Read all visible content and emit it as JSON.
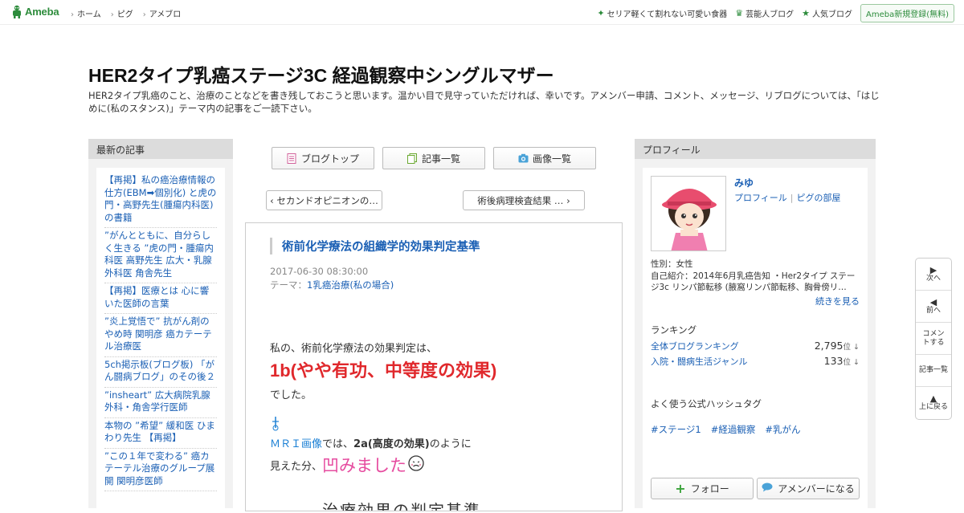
{
  "header": {
    "logo_text": "Ameba",
    "nav": [
      "ホーム",
      "ピグ",
      "アメブロ"
    ],
    "right_links": [
      {
        "icon": "sparkle-icon",
        "label": "セリア軽くて割れない可愛い食器"
      },
      {
        "icon": "crown-icon",
        "label": "芸能人ブログ"
      },
      {
        "icon": "star-icon",
        "label": "人気ブログ"
      }
    ],
    "register_label": "Ameba新規登録(無料)",
    "accent_color": "#2d8c3c"
  },
  "blog": {
    "title": "HER2タイプ乳癌ステージ3C 経過観察中シングルマザー",
    "description": "HER2タイプ乳癌のこと、治療のことなどを書き残しておこうと思います。温かい目で見守っていただければ、幸いです。アメンバー申請、コメント、メッセージ、リブログについては、「はじめに(私のスタンス)」テーマ内の記事をご一読下さい。"
  },
  "left_sidebar": {
    "heading": "最新の記事",
    "items": [
      "【再掲】私の癌治療情報の仕方(EBM➡個別化) と虎の門・高野先生(腫瘍内科医)の書籍",
      "”がんとともに、自分らしく生きる ”虎の門・腫瘍内科医 高野先生 広大・乳腺外科医 角舎先生",
      "【再掲】医療とは 心に響いた医師の言葉",
      "”炎上覚悟で” 抗がん剤のやめ時 関明彦 癌カテーテル治療医",
      "5ch掲示板(ブログ板) 「がん闘病ブログ」のその後２",
      "”insheart” 広大病院乳腺外科・角舎学行医師",
      "本物の ”希望” 緩和医 ひまわり先生 【再掲】",
      "”この１年で変わる” 癌カテーテル治療のグループ展開 関明彦医師"
    ]
  },
  "tabs": [
    {
      "icon": "document-icon",
      "label": "ブログトップ"
    },
    {
      "icon": "list-icon",
      "label": "記事一覧"
    },
    {
      "icon": "camera-icon",
      "label": "画像一覧"
    }
  ],
  "pager": {
    "prev": "‹ セカンドオピニオンの…",
    "next": "術後病理検査結果 … ›"
  },
  "article": {
    "title": "術前化学療法の組織学的効果判定基準",
    "date": "2017-06-30 08:30:00",
    "theme_prefix": "テーマ：",
    "theme": "1乳癌治療(私の場合)",
    "line1": "私の、術前化学療法の効果判定は、",
    "emphasis": "1b(やや有功、中等度の効果)",
    "line2": "でした。",
    "mri_link": "ＭＲＩ画像",
    "mri_mid": "では、",
    "mri_bold": "2a(高度の効果)",
    "mri_tail": "のように",
    "line4_pre": "見えた分、",
    "line4_pink": "凹みました",
    "cut_heading": "治療効果の判定基準"
  },
  "profile": {
    "heading": "プロフィール",
    "name": "みゆ",
    "link_profile": "プロフィール",
    "link_pig": "ピグの部屋",
    "gender": "性別：女性",
    "intro": "自己紹介：2014年6月乳癌告知 ・Her2タイプ ステージ3c リンパ節転移 (腋窩リンパ節転移、胸骨傍リ…",
    "more": "続きを見る",
    "ranking_heading": "ランキング",
    "rankings": [
      {
        "label": "全体ブログランキング",
        "value": "2,795",
        "unit": "位 ↓"
      },
      {
        "label": "入院・闘病生活ジャンル",
        "value": "133",
        "unit": "位 ↓"
      }
    ],
    "hashtag_heading": "よく使う公式ハッシュタグ",
    "hashtags": [
      "#ステージ1",
      "#経過観察",
      "#乳がん"
    ],
    "follow_label": "フォロー",
    "amember_label": "アメンバーになる"
  },
  "float_nav": [
    {
      "glyph": "▶",
      "label": "次へ"
    },
    {
      "glyph": "◀",
      "label": "前へ"
    },
    {
      "glyph": "",
      "label": "コメントする"
    },
    {
      "glyph": "",
      "label": "記事一覧"
    },
    {
      "glyph": "▲",
      "label": "上に戻る"
    }
  ]
}
